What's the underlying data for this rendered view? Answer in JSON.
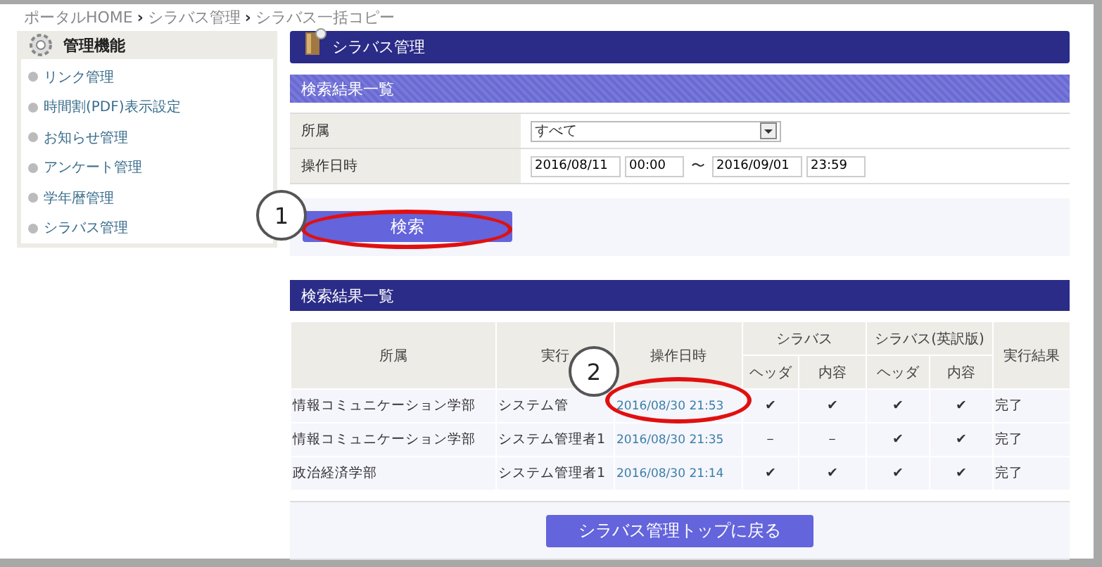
{
  "breadcrumb": [
    {
      "kind": "link",
      "text": "ポータルHOME"
    },
    {
      "kind": "separator",
      "text": "›"
    },
    {
      "kind": "link",
      "text": "シラバス管理"
    },
    {
      "kind": "separator",
      "text": "›"
    },
    {
      "kind": "link",
      "text": "シラバス一括コピー"
    }
  ],
  "sidebar": {
    "title": "管理機能",
    "items": [
      {
        "label": "リンク管理"
      },
      {
        "label": "時間割(PDF)表示設定"
      },
      {
        "label": "お知らせ管理"
      },
      {
        "label": "アンケート管理"
      },
      {
        "label": "学年暦管理"
      },
      {
        "label": "シラバス管理"
      }
    ]
  },
  "page_title": "シラバス管理",
  "search": {
    "title": "検索結果一覧",
    "affiliation": {
      "label": "所属",
      "value": "すべて"
    },
    "datetime": {
      "label": "操作日時",
      "from_date": "2016/08/11",
      "from_time": "00:00",
      "separator": "〜",
      "to_date": "2016/09/01",
      "to_time": "23:59"
    },
    "button": "検索"
  },
  "results": {
    "title": "検索結果一覧",
    "columns": [
      "所属",
      "実行",
      "操作日時",
      "シラバス",
      "シラバス(英訳版)",
      "実行結果"
    ],
    "subcolumns": [
      "ヘッダ",
      "内容",
      "ヘッダ",
      "内容"
    ],
    "rows": [
      {
        "affiliation": "情報コミュニケーション学部",
        "executor": "システム管",
        "datetime": "2016/08/30 21:53",
        "marks": [
          "✔",
          "✔",
          "✔",
          "✔"
        ],
        "result": "完了"
      },
      {
        "affiliation": "情報コミュニケーション学部",
        "executor": "システム管理者1",
        "datetime": "2016/08/30 21:35",
        "marks": [
          "－",
          "－",
          "✔",
          "✔"
        ],
        "result": "完了"
      },
      {
        "affiliation": "政治経済学部",
        "executor": "システム管理者1",
        "datetime": "2016/08/30 21:14",
        "marks": [
          "✔",
          "✔",
          "✔",
          "✔"
        ],
        "result": "完了"
      }
    ]
  },
  "back_button": "シラバス管理トップに戻る",
  "annotations": [
    {
      "label": "1"
    },
    {
      "label": "2"
    }
  ]
}
